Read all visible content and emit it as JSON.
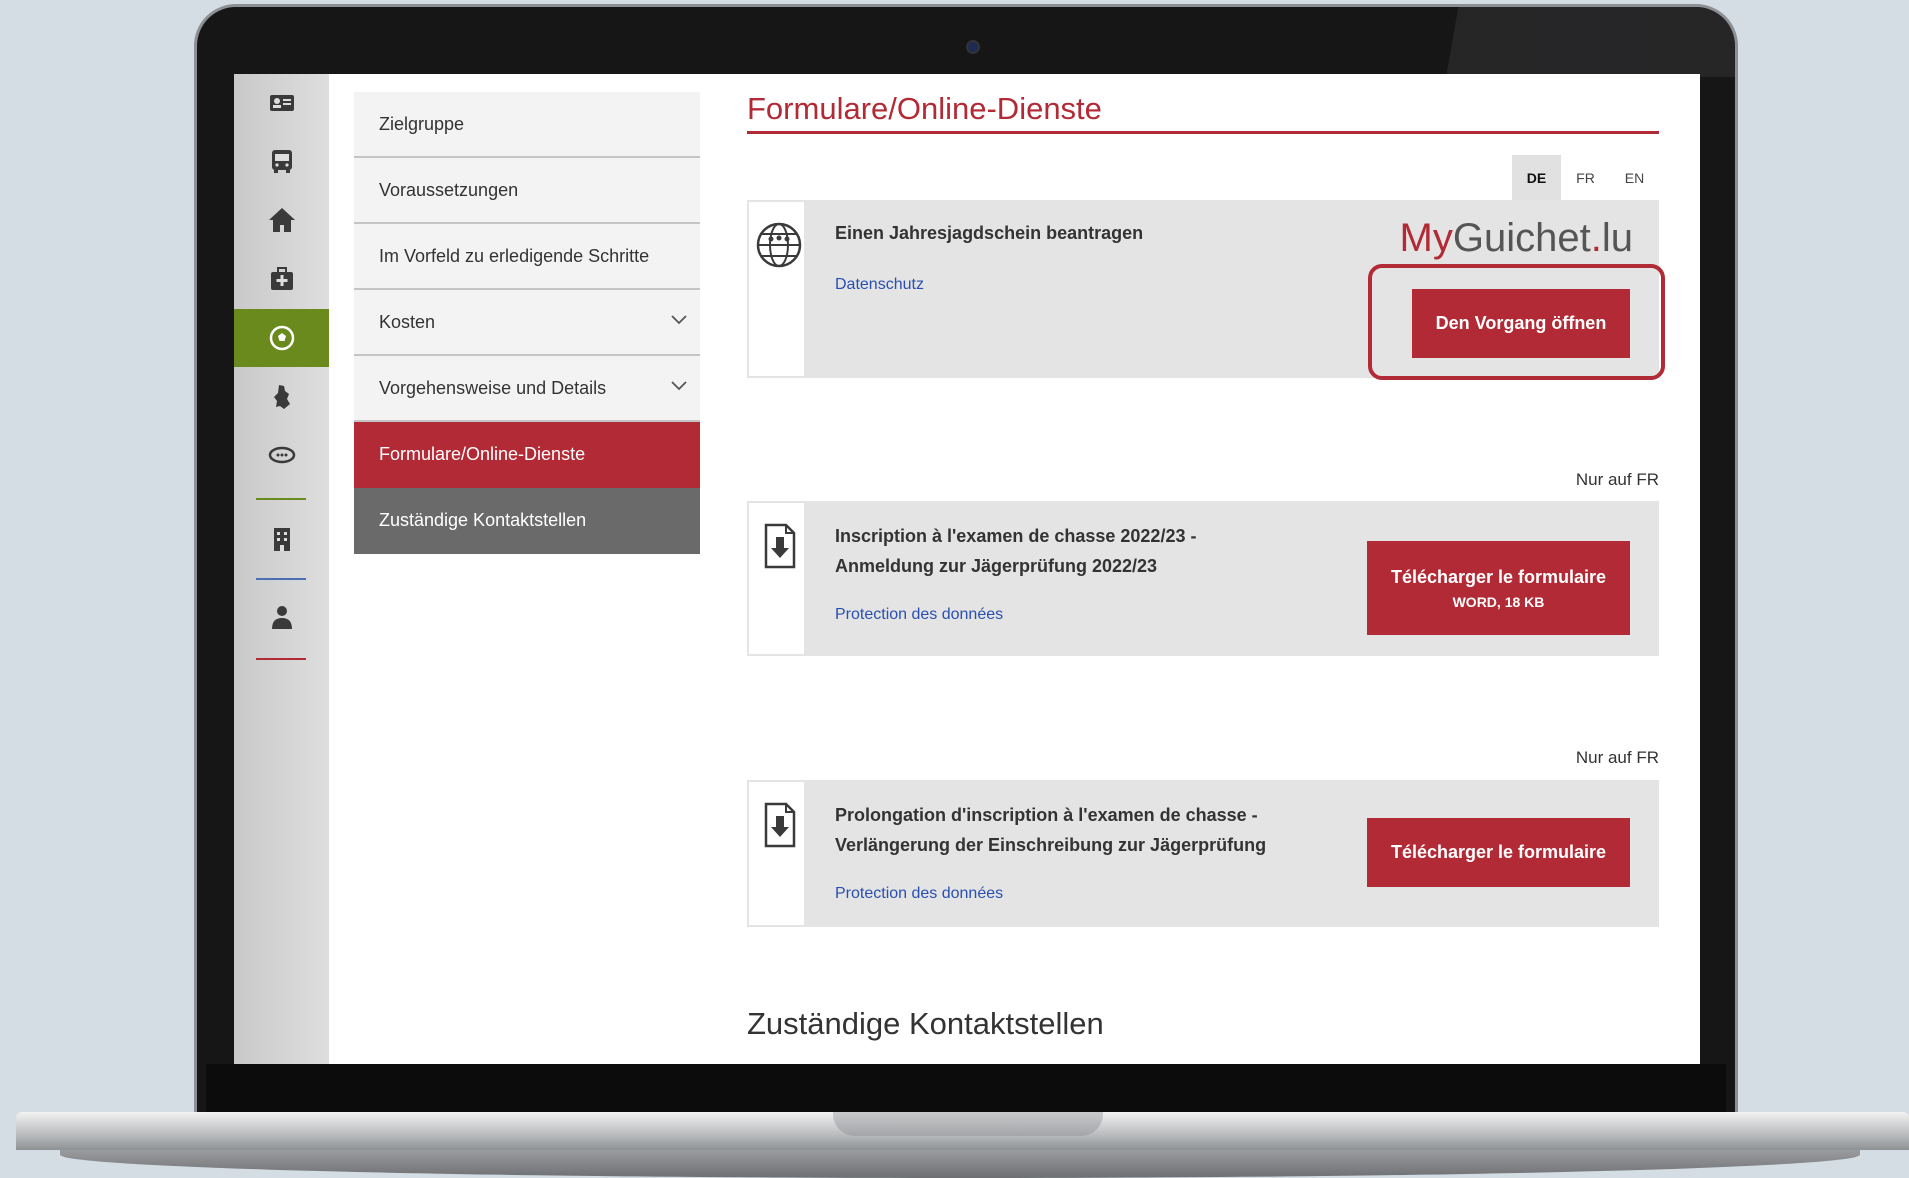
{
  "colors": {
    "accent": "#b22a35",
    "active_rail": "#6a8a1e",
    "link": "#2a4fb0"
  },
  "rail": {
    "items": [
      {
        "icon": "id-card-icon"
      },
      {
        "icon": "bus-icon"
      },
      {
        "icon": "home-icon"
      },
      {
        "icon": "medical-kit-icon"
      },
      {
        "icon": "football-icon",
        "active": true
      },
      {
        "icon": "luxembourg-map-icon"
      },
      {
        "icon": "europe-icon"
      },
      {
        "icon": "building-icon"
      },
      {
        "icon": "person-icon"
      }
    ]
  },
  "subnav": {
    "items": [
      {
        "label": "Zielgruppe"
      },
      {
        "label": "Voraussetzungen"
      },
      {
        "label": "Im Vorfeld zu erledigende Schritte"
      },
      {
        "label": "Kosten",
        "expandable": true
      },
      {
        "label": "Vorgehensweise und Details",
        "expandable": true
      },
      {
        "label": "Formulare/Online-Dienste",
        "active": true
      },
      {
        "label": "Zuständige Kontaktstellen"
      }
    ]
  },
  "main": {
    "title": "Formulare/Online-Dienste",
    "languages": [
      "DE",
      "FR",
      "EN"
    ],
    "active_language": "DE",
    "cards": [
      {
        "title": "Einen Jahresjagdschein beantragen",
        "link": "Datenschutz",
        "logo_my": "My",
        "logo_guichet": "Guichet",
        "logo_dot": ".",
        "logo_lu": "lu",
        "button": "Den Vorgang öffnen"
      },
      {
        "note": "Nur auf FR",
        "title_line1": "Inscription à l'examen de chasse 2022/23 -",
        "title_line2": "Anmeldung zur Jägerprüfung 2022/23",
        "link": "Protection des données",
        "button": "Télécharger le formulaire",
        "button_sub": "WORD, 18 KB"
      },
      {
        "note": "Nur auf FR",
        "title_line1": "Prolongation d'inscription à l'examen de chasse -",
        "title_line2": "Verlängerung der Einschreibung zur Jägerprüfung",
        "link": "Protection des données",
        "button": "Télécharger le formulaire"
      }
    ],
    "next_heading": "Zuständige Kontaktstellen"
  }
}
